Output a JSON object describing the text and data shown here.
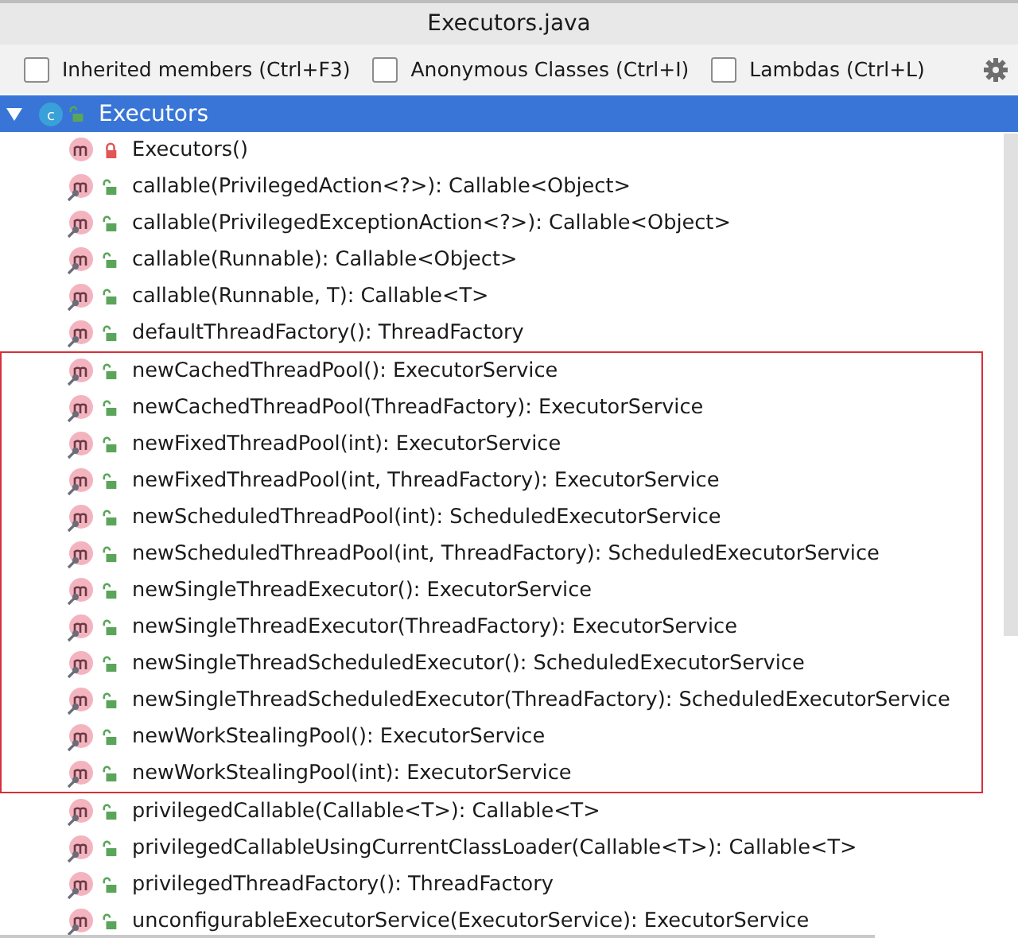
{
  "window": {
    "title": "Executors.java"
  },
  "filters": [
    {
      "label": "Inherited members (Ctrl+F3)",
      "checked": false
    },
    {
      "label": "Anonymous Classes (Ctrl+I)",
      "checked": false
    },
    {
      "label": "Lambdas (Ctrl+L)",
      "checked": false
    }
  ],
  "tree": {
    "label": "Executors",
    "icon_letter": "c",
    "kind": "public",
    "expanded": true,
    "selected": true,
    "children": [
      {
        "label": "Executors()",
        "kind": "private",
        "static": false,
        "highlighted": false
      },
      {
        "label": "callable(PrivilegedAction<?>): Callable<Object>",
        "kind": "public",
        "static": true,
        "highlighted": false
      },
      {
        "label": "callable(PrivilegedExceptionAction<?>): Callable<Object>",
        "kind": "public",
        "static": true,
        "highlighted": false
      },
      {
        "label": "callable(Runnable): Callable<Object>",
        "kind": "public",
        "static": true,
        "highlighted": false
      },
      {
        "label": "callable(Runnable, T): Callable<T>",
        "kind": "public",
        "static": true,
        "highlighted": false
      },
      {
        "label": "defaultThreadFactory(): ThreadFactory",
        "kind": "public",
        "static": true,
        "highlighted": false
      },
      {
        "label": "newCachedThreadPool(): ExecutorService",
        "kind": "public",
        "static": true,
        "highlighted": true
      },
      {
        "label": "newCachedThreadPool(ThreadFactory): ExecutorService",
        "kind": "public",
        "static": true,
        "highlighted": true
      },
      {
        "label": "newFixedThreadPool(int): ExecutorService",
        "kind": "public",
        "static": true,
        "highlighted": true
      },
      {
        "label": "newFixedThreadPool(int, ThreadFactory): ExecutorService",
        "kind": "public",
        "static": true,
        "highlighted": true
      },
      {
        "label": "newScheduledThreadPool(int): ScheduledExecutorService",
        "kind": "public",
        "static": true,
        "highlighted": true
      },
      {
        "label": "newScheduledThreadPool(int, ThreadFactory): ScheduledExecutorService",
        "kind": "public",
        "static": true,
        "highlighted": true
      },
      {
        "label": "newSingleThreadExecutor(): ExecutorService",
        "kind": "public",
        "static": true,
        "highlighted": true
      },
      {
        "label": "newSingleThreadExecutor(ThreadFactory): ExecutorService",
        "kind": "public",
        "static": true,
        "highlighted": true
      },
      {
        "label": "newSingleThreadScheduledExecutor(): ScheduledExecutorService",
        "kind": "public",
        "static": true,
        "highlighted": true
      },
      {
        "label": "newSingleThreadScheduledExecutor(ThreadFactory): ScheduledExecutorService",
        "kind": "public",
        "static": true,
        "highlighted": true
      },
      {
        "label": "newWorkStealingPool(): ExecutorService",
        "kind": "public",
        "static": true,
        "highlighted": true
      },
      {
        "label": "newWorkStealingPool(int): ExecutorService",
        "kind": "public",
        "static": true,
        "highlighted": true
      },
      {
        "label": "privilegedCallable(Callable<T>): Callable<T>",
        "kind": "public",
        "static": true,
        "highlighted": false
      },
      {
        "label": "privilegedCallableUsingCurrentClassLoader(Callable<T>): Callable<T>",
        "kind": "public",
        "static": true,
        "highlighted": false
      },
      {
        "label": "privilegedThreadFactory(): ThreadFactory",
        "kind": "public",
        "static": true,
        "highlighted": false
      },
      {
        "label": "unconfigurableExecutorService(ExecutorService): ExecutorService",
        "kind": "public",
        "static": true,
        "highlighted": false
      }
    ]
  }
}
